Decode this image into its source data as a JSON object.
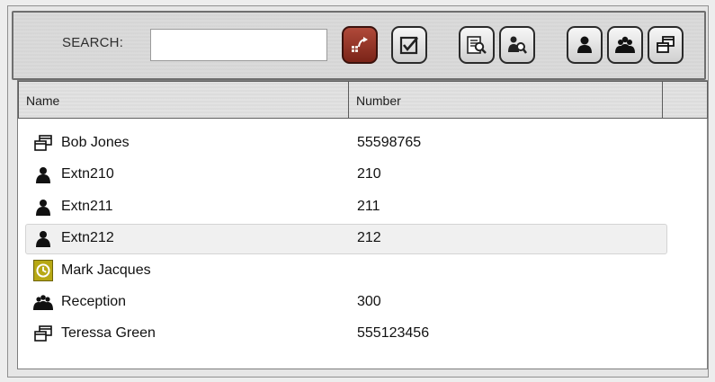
{
  "toolbar": {
    "search_label": "SEARCH:",
    "search_value": "",
    "buttons": [
      {
        "icon": "transfer-icon"
      },
      {
        "icon": "checkbox-icon"
      },
      {
        "icon": "directory-search-icon"
      },
      {
        "icon": "user-search-icon"
      },
      {
        "icon": "user-icon"
      },
      {
        "icon": "group-icon"
      },
      {
        "icon": "windows-icon"
      }
    ]
  },
  "columns": [
    "Name",
    "Number"
  ],
  "rows": [
    {
      "icon": "contact-windows-icon",
      "name": "Bob Jones",
      "number": "55598765",
      "selected": false
    },
    {
      "icon": "user-icon",
      "name": "Extn210",
      "number": "210",
      "selected": false
    },
    {
      "icon": "user-icon",
      "name": "Extn211",
      "number": "211",
      "selected": false
    },
    {
      "icon": "user-icon",
      "name": "Extn212",
      "number": "212",
      "selected": true
    },
    {
      "icon": "schedule-icon",
      "name": "Mark Jacques",
      "number": "",
      "selected": false
    },
    {
      "icon": "group-icon",
      "name": "Reception",
      "number": "300",
      "selected": false
    },
    {
      "icon": "contact-windows-icon",
      "name": "Teressa Green",
      "number": "555123456",
      "selected": false
    }
  ],
  "colors": {
    "accent_brown": "#8b2f22",
    "schedule_yellow": "#b7a814"
  }
}
